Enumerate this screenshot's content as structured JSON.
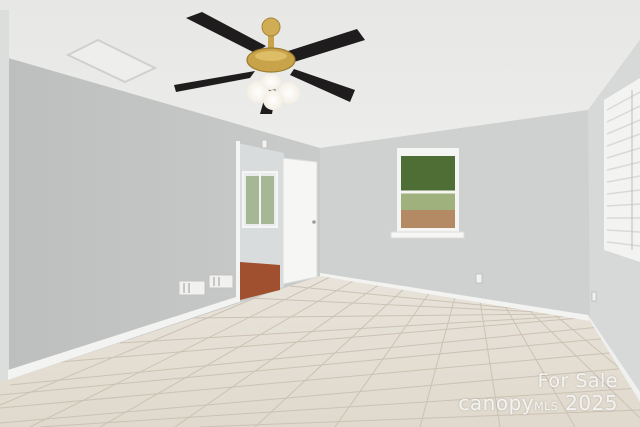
{
  "scene": {
    "description_kind": "photo",
    "colors": {
      "ceiling": "#e8e8e6",
      "left_wall": "#c4c6c6",
      "back_wall": "#cfd1d1",
      "right_wall": "#d6d7d7",
      "floor_tile": "#e3ddd2",
      "grout": "#cfc6b8",
      "baseboard": "#f4f4f2",
      "wood_floor": "#a1502f",
      "fan_blade": "#1e1c1c",
      "fan_brass": "#c8a34a"
    }
  },
  "watermark": {
    "line1": "For Sale",
    "line2_prefix": "canopy",
    "line2_mid": "MLS",
    "line2_year": "2025"
  }
}
